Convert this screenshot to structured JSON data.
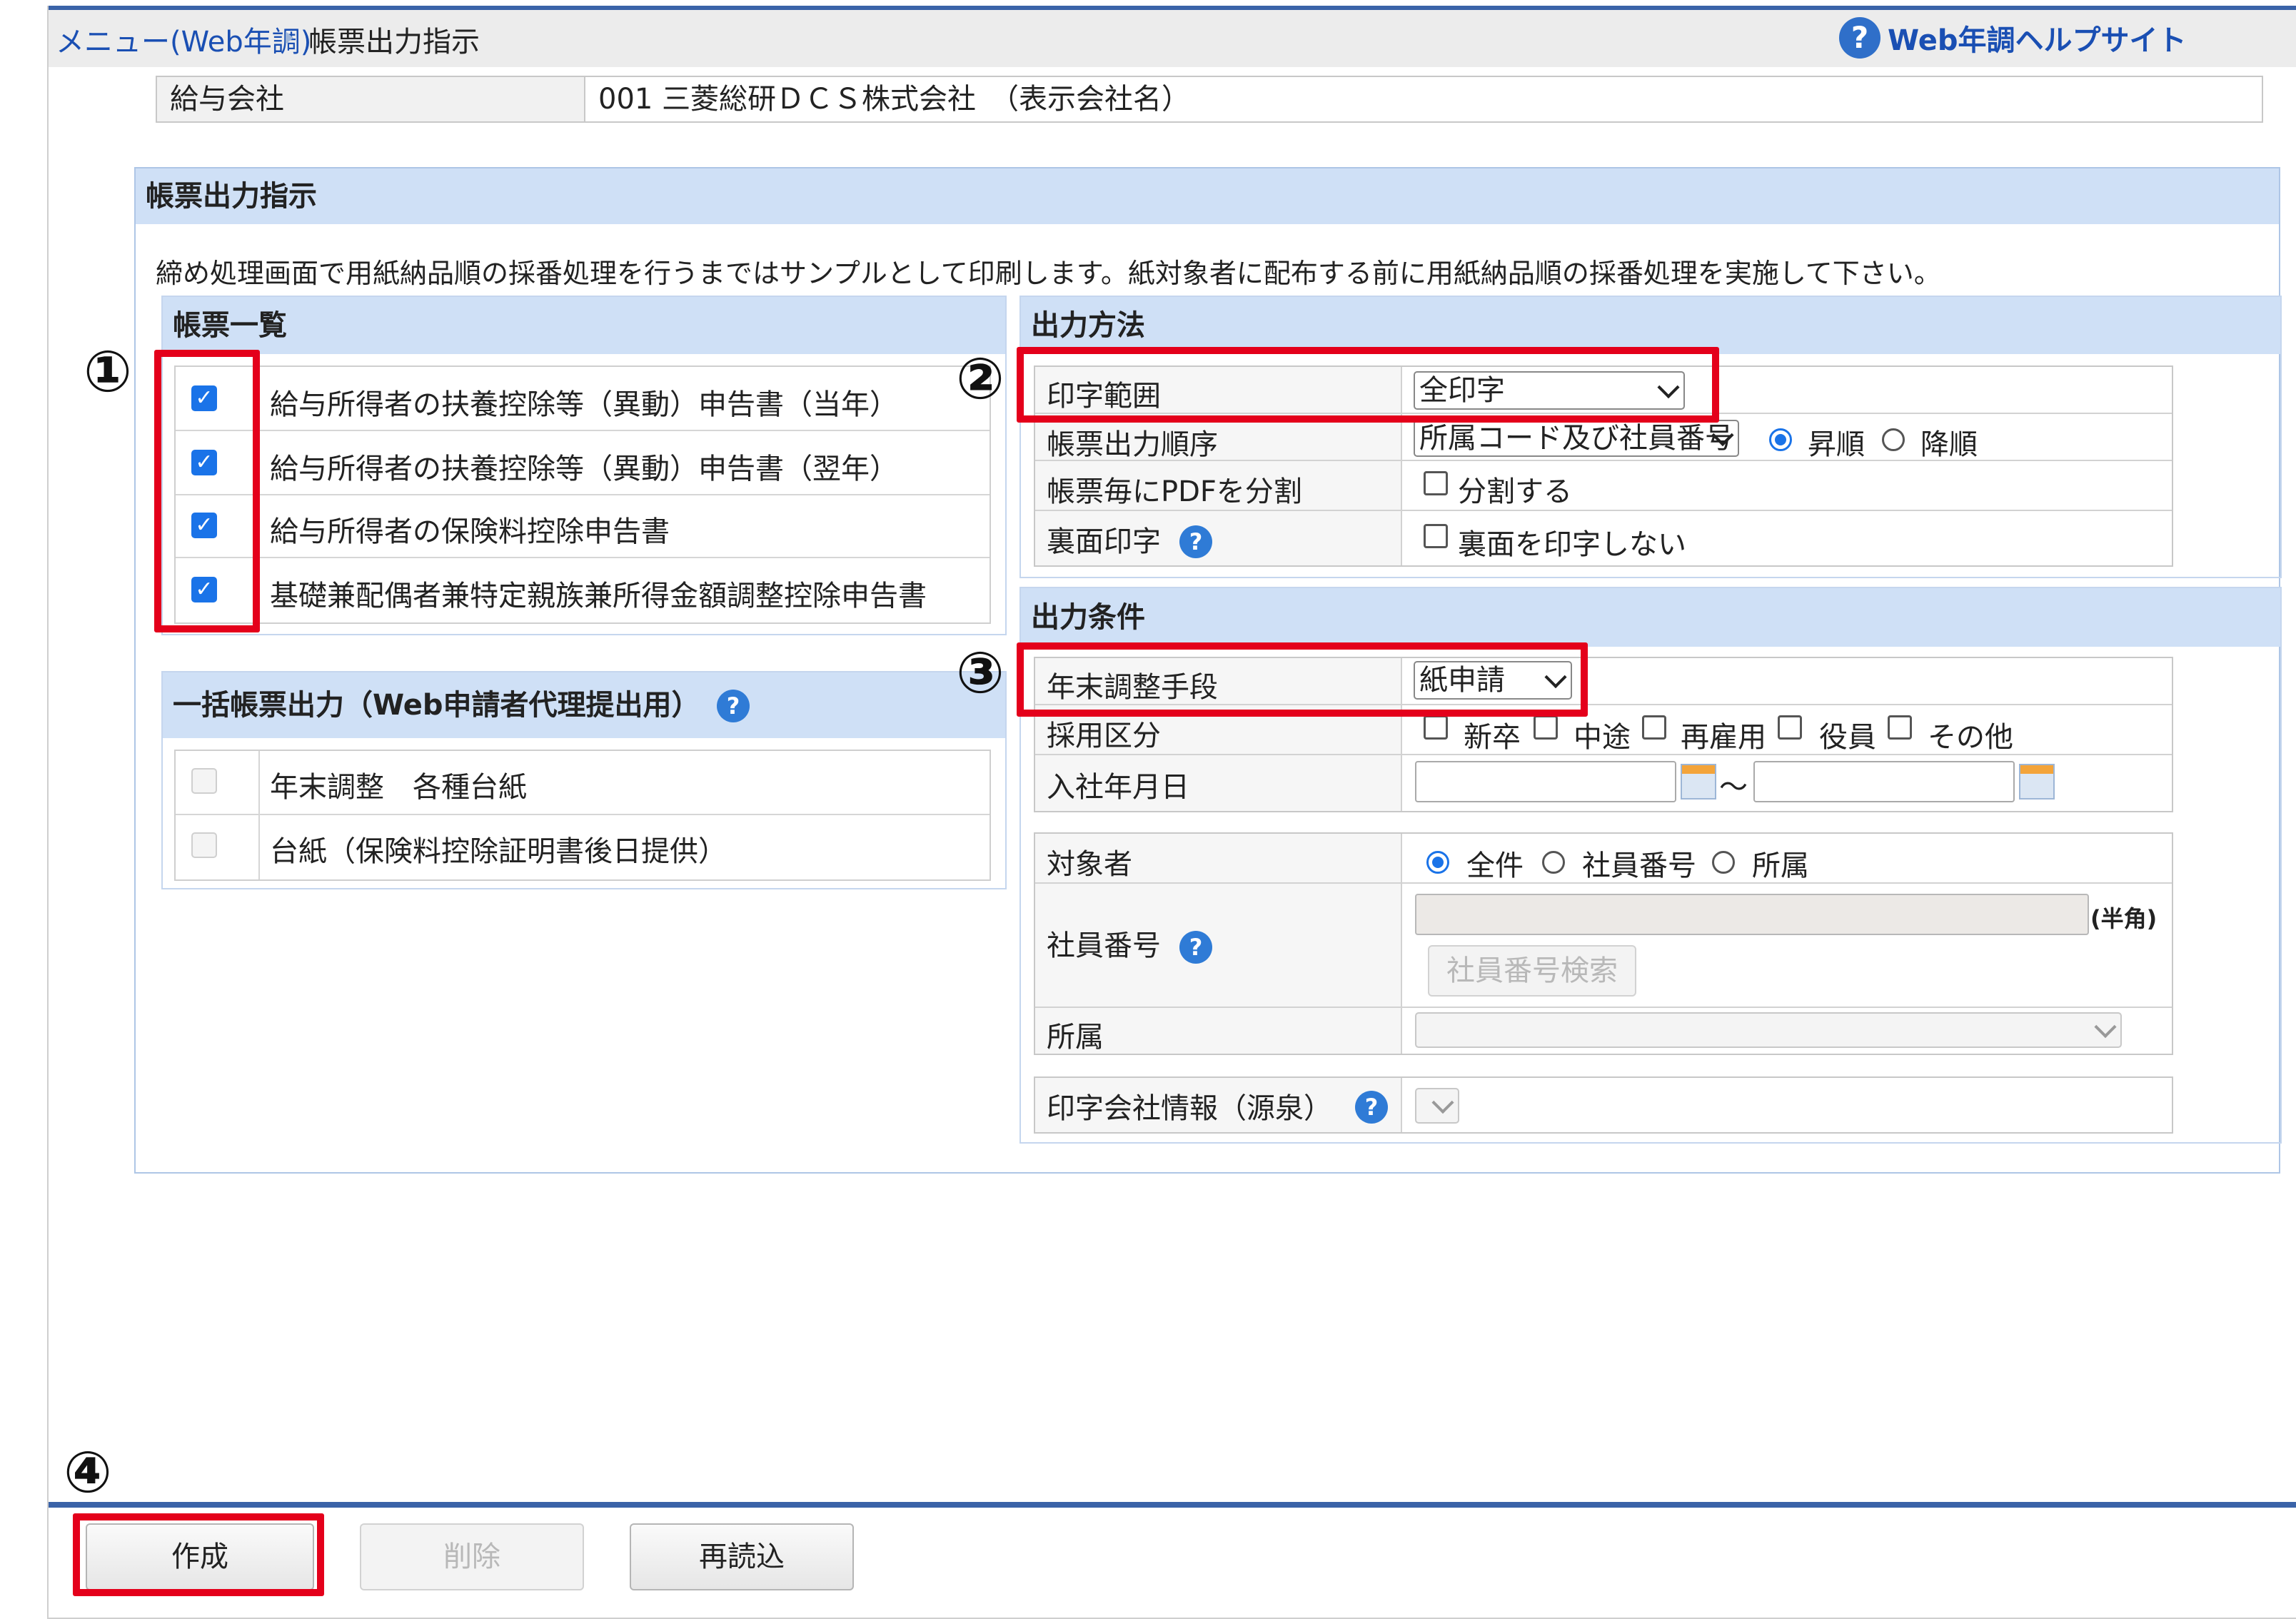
{
  "breadcrumb": {
    "menu_link": "メニュー(Web年調)",
    "current": "帳票出力指示"
  },
  "help": {
    "icon": "?",
    "label": "Web年調ヘルプサイト"
  },
  "company": {
    "label": "給与会社",
    "value": "001 三菱総研ＤＣＳ株式会社　（表示会社名）"
  },
  "panel": {
    "title": "帳票出力指示",
    "notice": "締め処理画面で用紙納品順の採番処理を行うまではサンプルとして印刷します。紙対象者に配布する前に用紙納品順の採番処理を実施して下さい。"
  },
  "form_list": {
    "title": "帳票一覧",
    "items": [
      {
        "label": "給与所得者の扶養控除等（異動）申告書（当年）",
        "checked": true
      },
      {
        "label": "給与所得者の扶養控除等（異動）申告書（翌年）",
        "checked": true
      },
      {
        "label": "給与所得者の保険料控除申告書",
        "checked": true
      },
      {
        "label": "基礎兼配偶者兼特定親族兼所得金額調整控除申告書",
        "checked": true
      }
    ]
  },
  "bulk_output": {
    "title": "一括帳票出力（Web申請者代理提出用）",
    "items": [
      {
        "label": "年末調整　各種台紙",
        "checked": false
      },
      {
        "label": "台紙（保険料控除証明書後日提供）",
        "checked": false
      }
    ]
  },
  "output_method": {
    "title": "出力方法",
    "print_range": {
      "label": "印字範囲",
      "value": "全印字"
    },
    "order": {
      "label": "帳票出力順序",
      "value": "所属コード及び社員番号",
      "asc": "昇順",
      "desc": "降順",
      "selected": "asc"
    },
    "split_pdf": {
      "label": "帳票毎にPDFを分割",
      "option": "分割する",
      "checked": false
    },
    "back_print": {
      "label": "裏面印字",
      "option": "裏面を印字しない",
      "checked": false
    }
  },
  "output_conditions": {
    "title": "出力条件",
    "method": {
      "label": "年末調整手段",
      "value": "紙申請"
    },
    "hire_type": {
      "label": "採用区分",
      "options": [
        "新卒",
        "中途",
        "再雇用",
        "役員",
        "その他"
      ]
    },
    "hire_date": {
      "label": "入社年月日",
      "separator": "～",
      "from": "",
      "to": ""
    },
    "target": {
      "label": "対象者",
      "options": [
        "全件",
        "社員番号",
        "所属"
      ],
      "selected": "全件"
    },
    "employee_no": {
      "label": "社員番号",
      "value": "",
      "note": "(半角)",
      "search_button": "社員番号検索"
    },
    "department": {
      "label": "所属",
      "value": ""
    },
    "print_company": {
      "label": "印字会社情報（源泉）",
      "value": ""
    }
  },
  "buttons": {
    "create": "作成",
    "delete": "削除",
    "reload": "再読込"
  },
  "annotations": [
    "①",
    "②",
    "③",
    "④"
  ]
}
